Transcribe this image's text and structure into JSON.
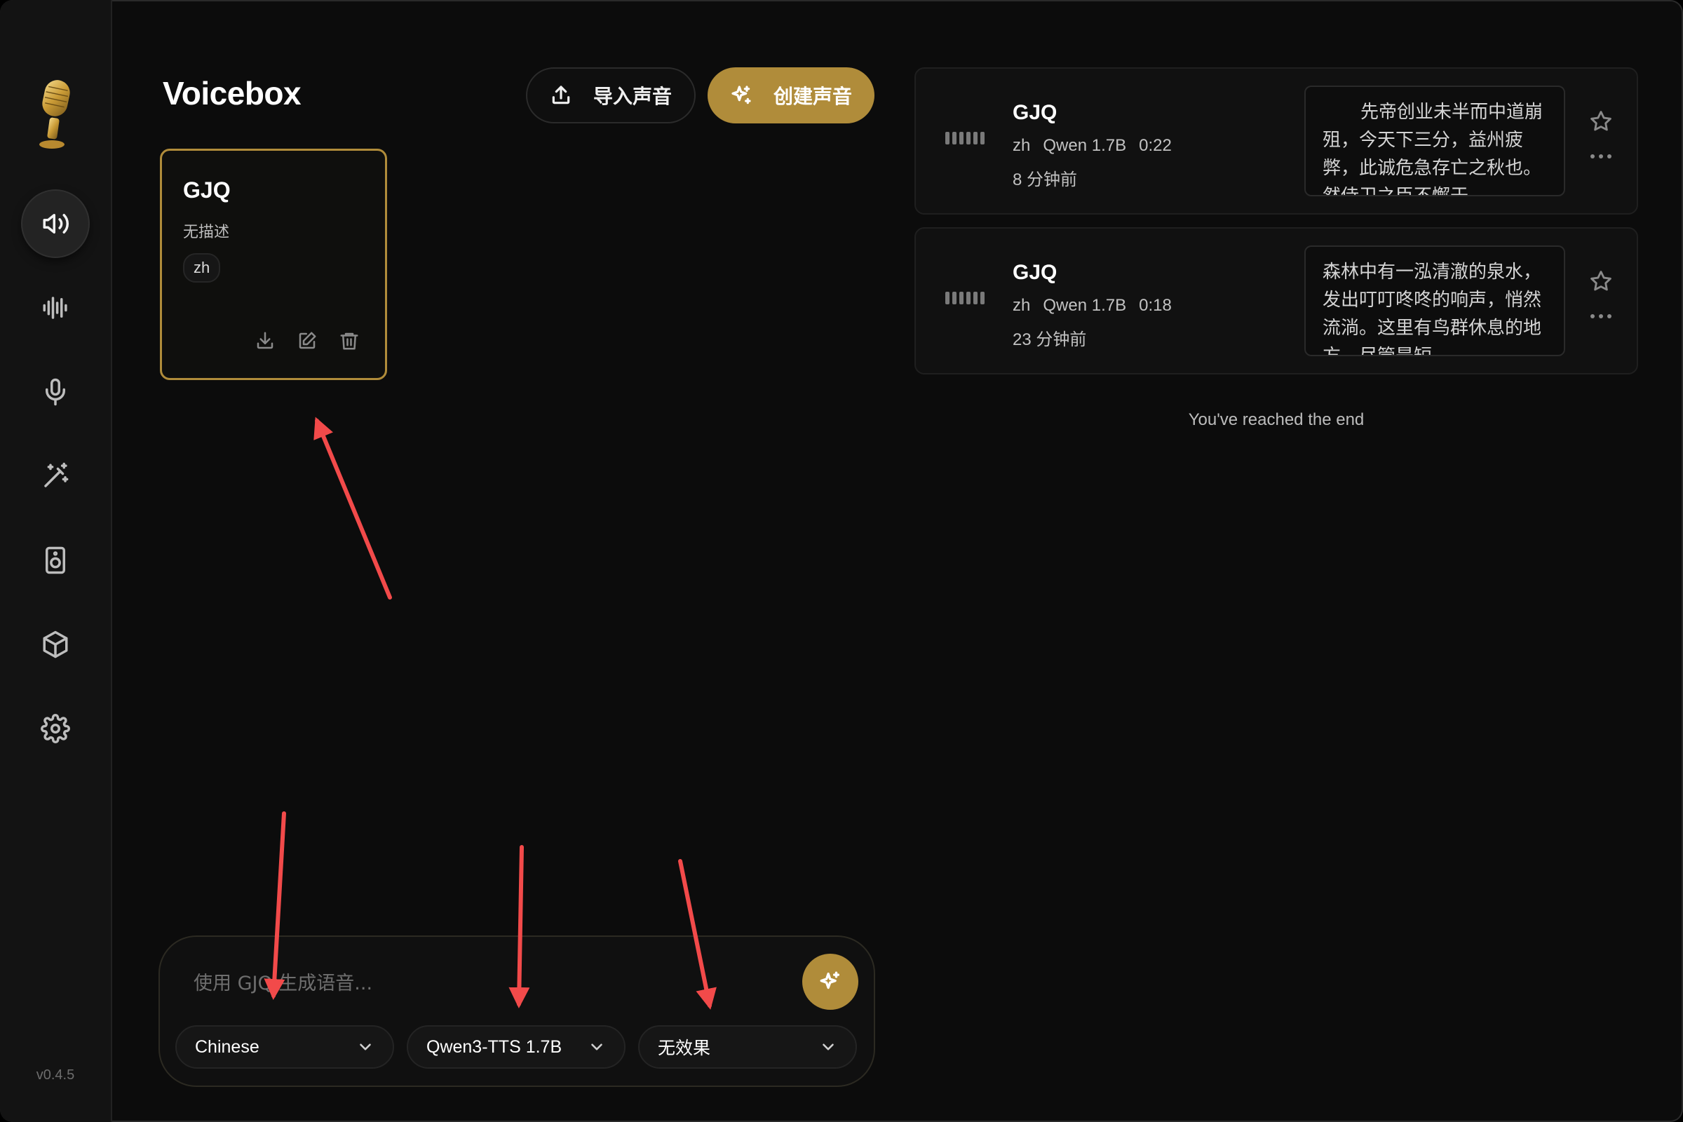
{
  "app": {
    "title": "Voicebox",
    "version": "v0.4.5"
  },
  "sidebar": {
    "items": [
      {
        "name": "voices",
        "icon": "speaker-icon",
        "active": true
      },
      {
        "name": "waveform",
        "icon": "waveform-icon",
        "active": false
      },
      {
        "name": "record",
        "icon": "microphone-icon",
        "active": false
      },
      {
        "name": "effects",
        "icon": "magic-wand-icon",
        "active": false
      },
      {
        "name": "speaker",
        "icon": "speaker-box-icon",
        "active": false
      },
      {
        "name": "models",
        "icon": "cube-icon",
        "active": false
      },
      {
        "name": "settings",
        "icon": "gear-icon",
        "active": false
      }
    ]
  },
  "header": {
    "import_label": "导入声音",
    "create_label": "创建声音"
  },
  "profile": {
    "name": "GJQ",
    "description": "无描述",
    "language": "zh"
  },
  "history": {
    "items": [
      {
        "title": "GJQ",
        "language": "zh",
        "model": "Qwen 1.7B",
        "duration": "0:22",
        "time": "8 分钟前",
        "text": "先帝创业未半而中道崩殂，今天下三分，益州疲弊，此诚危急存亡之秋也。然侍卫之臣不懈于"
      },
      {
        "title": "GJQ",
        "language": "zh",
        "model": "Qwen 1.7B",
        "duration": "0:18",
        "time": "23 分钟前",
        "text": "森林中有一泓清澈的泉水，发出叮叮咚咚的响声，悄然流淌。这里有鸟群休息的地方，尽管是短"
      }
    ],
    "end_text": "You've reached the end"
  },
  "composer": {
    "placeholder": "使用 GJQ 生成语音...",
    "language": "Chinese",
    "model": "Qwen3-TTS 1.7B",
    "effect": "无效果"
  },
  "colors": {
    "accent": "#b08c3a",
    "annotation_arrow": "#f24a4a"
  }
}
